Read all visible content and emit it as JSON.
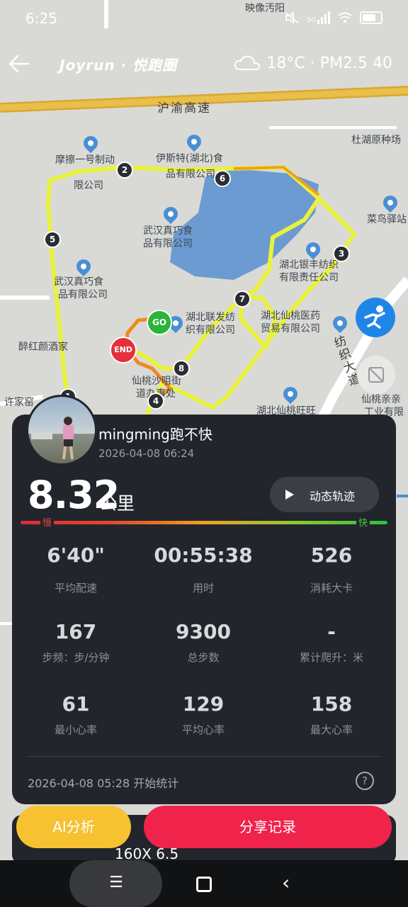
{
  "status_bar": {
    "time": "6:25",
    "network": "5G"
  },
  "header": {
    "brand": "Joyrun · 悦跑圈",
    "weather": "18°C · PM2.5 40"
  },
  "map": {
    "road_labels": [
      "沪渝高速",
      "纺织大道"
    ],
    "pois": [
      "映像汚阳",
      "杜湖原种场",
      "摩擦一号制动",
      "限公司",
      "伊斯特(湖北)食",
      "品有限公司",
      "菜鸟驿站",
      "武汉真巧食",
      "品有限公司",
      "湖北银丰纺织",
      "有限责任公司",
      "武汉真巧食",
      "品有限公司",
      "湖北联发纺",
      "织有限公司",
      "湖北仙桃医药",
      "贸易有限公司",
      "醉红颜酒家",
      "仙桃沙咀街",
      "道办事处",
      "许家窑",
      "湖北仙桃旺旺",
      "仙桃亲亲",
      "工业有限"
    ],
    "markers": [
      "2",
      "6",
      "5",
      "3",
      "7",
      "8",
      "4",
      "1"
    ],
    "start_label": "GO",
    "end_label": "END"
  },
  "summary": {
    "username": "mingming跑不快",
    "datetime": "2026-04-08 06:24",
    "distance": "8.32",
    "distance_unit": "公里",
    "replay_label": "动态轨迹",
    "pace_slow": "慢",
    "pace_fast": "快",
    "stats": [
      {
        "value": "6'40\"",
        "label": "平均配速"
      },
      {
        "value": "00:55:38",
        "label": "用时"
      },
      {
        "value": "526",
        "label": "消耗大卡"
      },
      {
        "value": "167",
        "label": "步频：步/分钟"
      },
      {
        "value": "9300",
        "label": "总步数"
      },
      {
        "value": "-",
        "label": "累计爬升：米"
      },
      {
        "value": "61",
        "label": "最小心率"
      },
      {
        "value": "129",
        "label": "平均心率"
      },
      {
        "value": "158",
        "label": "最大心率"
      }
    ],
    "start_stat": "2026-04-08 05:28  开始统计",
    "help": "?"
  },
  "peek_text": "160X 6.5",
  "actions": {
    "ai_label": "AI分析",
    "share_label": "分享记录"
  },
  "colors": {
    "share": "#f0234b",
    "ai": "#f6c232",
    "card": "#22252b",
    "route": "#e9f23a"
  }
}
